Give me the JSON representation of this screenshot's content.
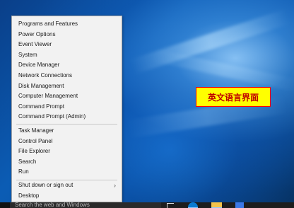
{
  "menu": {
    "group1": [
      "Programs and Features",
      "Power Options",
      "Event Viewer",
      "System",
      "Device Manager",
      "Network Connections",
      "Disk Management",
      "Computer Management",
      "Command Prompt",
      "Command Prompt (Admin)"
    ],
    "group2": [
      "Task Manager",
      "Control Panel",
      "File Explorer",
      "Search",
      "Run"
    ],
    "group3": [
      "Shut down or sign out",
      "Desktop"
    ],
    "submenu_arrow": "›"
  },
  "overlay_label": "英文语言界面",
  "taskbar": {
    "search_placeholder": "Search the web and Windows"
  },
  "colors": {
    "menu_background": "#f2f2f2",
    "label_background": "#ffff00",
    "label_text": "#c00000",
    "taskbar_background": "#1d1d1d",
    "edge_blue": "#0b7ad1",
    "folder_yellow": "#f4c34a"
  },
  "icons": {
    "start": "windows-start-icon",
    "task_view": "task-view-icon",
    "edge": "edge-icon",
    "file_explorer": "folder-icon",
    "store": "store-icon"
  }
}
